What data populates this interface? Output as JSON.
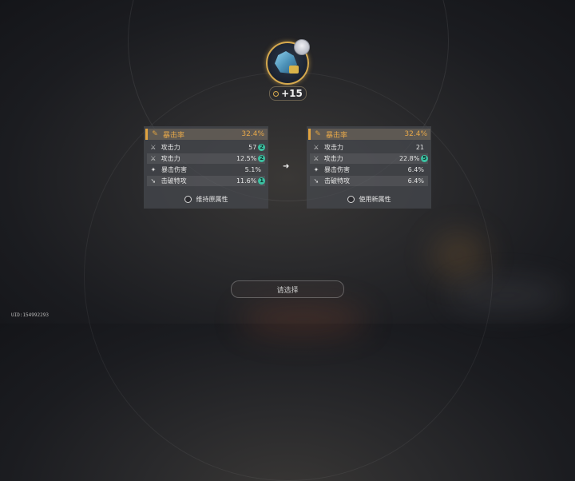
{
  "relic": {
    "level": "+15"
  },
  "left_panel": {
    "main_stat": {
      "name": "暴击率",
      "value": "32.4%",
      "icon": "crit-rate-icon"
    },
    "substats": [
      {
        "name": "攻击力",
        "value": "57",
        "badge": "2",
        "icon": "sword-icon"
      },
      {
        "name": "攻击力",
        "value": "12.5%",
        "badge": "2",
        "icon": "sword-icon"
      },
      {
        "name": "暴击伤害",
        "value": "5.1%",
        "badge": "",
        "icon": "crit-dmg-icon"
      },
      {
        "name": "击破特攻",
        "value": "11.6%",
        "badge": "1",
        "icon": "break-effect-icon"
      }
    ],
    "choice_label": "维持原属性"
  },
  "right_panel": {
    "main_stat": {
      "name": "暴击率",
      "value": "32.4%",
      "icon": "crit-rate-icon"
    },
    "substats": [
      {
        "name": "攻击力",
        "value": "21",
        "badge": "",
        "icon": "sword-icon"
      },
      {
        "name": "攻击力",
        "value": "22.8%",
        "badge": "5",
        "icon": "sword-icon"
      },
      {
        "name": "暴击伤害",
        "value": "6.4%",
        "badge": "",
        "icon": "crit-dmg-icon"
      },
      {
        "name": "击破特攻",
        "value": "6.4%",
        "badge": "",
        "icon": "break-effect-icon"
      }
    ],
    "choice_label": "使用新属性"
  },
  "confirm_label": "请选择",
  "uid": "UID:154992293",
  "colors": {
    "accent": "#e0a340",
    "badge": "#3bbfa0"
  }
}
